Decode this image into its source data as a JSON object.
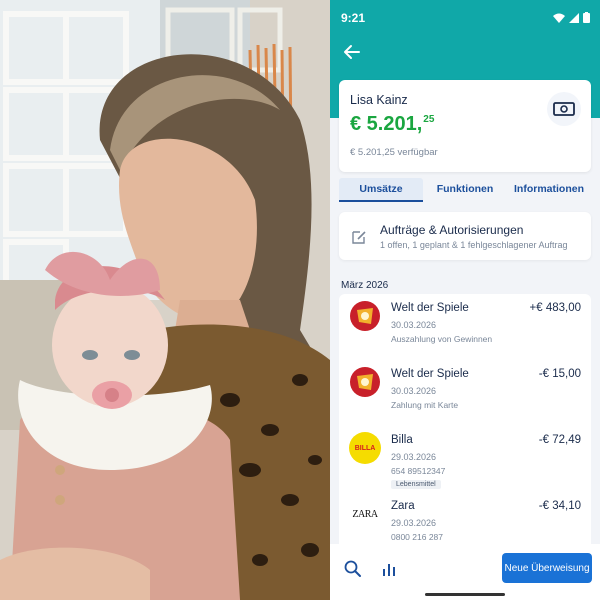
{
  "status": {
    "time": "9:21"
  },
  "account": {
    "owner": "Lisa Kainz",
    "balance_main": "€ 5.201,",
    "balance_cents": "25",
    "available": "€ 5.201,25 verfügbar"
  },
  "tabs": [
    {
      "label": "Umsätze",
      "active": true
    },
    {
      "label": "Funktionen",
      "active": false
    },
    {
      "label": "Informationen",
      "active": false
    }
  ],
  "orders": {
    "title": "Aufträge & Autorisierungen",
    "subtitle": "1 offen, 1 geplant & 1 fehlgeschlagener Auftrag"
  },
  "month_label": "März 2026",
  "transactions": [
    {
      "name": "Welt der Spiele",
      "date": "30.03.2026",
      "desc": "Auszahlung von Gewinnen",
      "amount": "+€ 483,00",
      "logo": "welt-der-spiele-logo"
    },
    {
      "name": "Welt der Spiele",
      "date": "30.03.2026",
      "desc": "Zahlung mit Karte",
      "amount": "-€ 15,00",
      "logo": "welt-der-spiele-logo"
    },
    {
      "name": "Billa",
      "date": "29.03.2026",
      "desc": "654 89512347",
      "tag": "Lebensmittel",
      "amount": "-€ 72,49",
      "logo_text": "BILLA"
    },
    {
      "name": "Zara",
      "date": "29.03.2026",
      "desc": "0800 216 287",
      "amount": "-€ 34,10",
      "logo_text": "ZARA"
    }
  ],
  "bottom": {
    "new_transfer": "Neue Überweisung"
  },
  "colors": {
    "teal": "#10a8a8",
    "green": "#1aa640",
    "blue": "#1c4f9c",
    "button": "#1a72d6",
    "billa": "#f5dc00"
  }
}
